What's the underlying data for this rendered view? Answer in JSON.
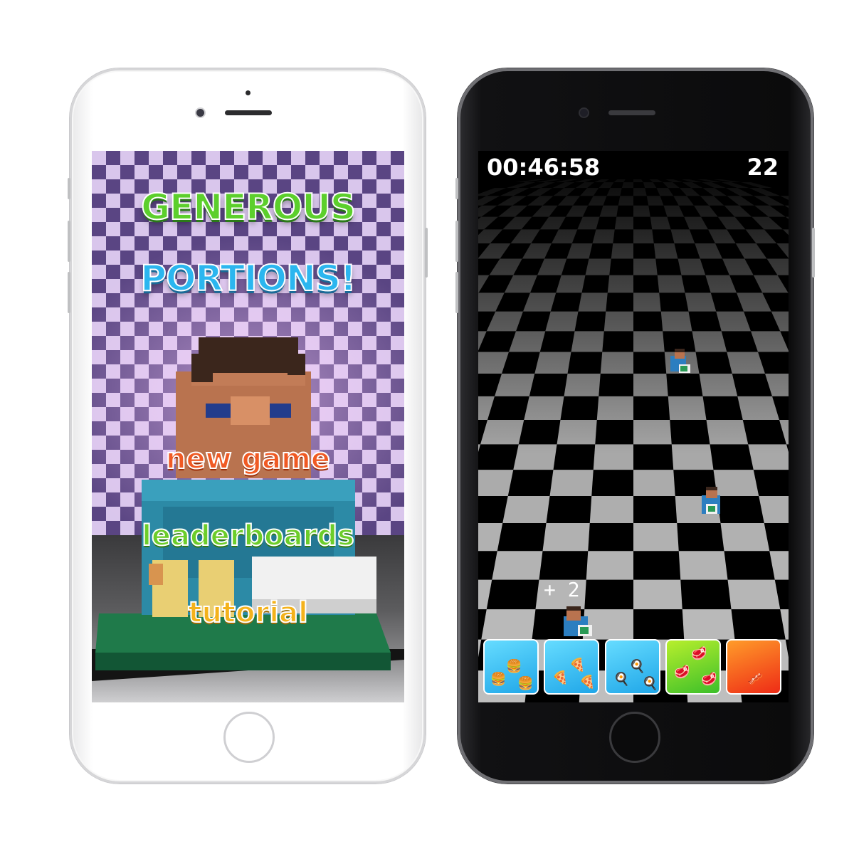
{
  "menu_screen": {
    "title_line1": "GENEROUS",
    "title_line2": "PORTIONS!",
    "menu": {
      "new_game": "new game",
      "leaderboards": "leaderboards",
      "tutorial": "tutorial"
    }
  },
  "game_screen": {
    "timer": "00:46:58",
    "score": "22",
    "combo_popup": "+ 2",
    "food_tiles": [
      {
        "food": "burger-icon",
        "color": "blue"
      },
      {
        "food": "pizza-icon",
        "color": "blue"
      },
      {
        "food": "egg-icon",
        "color": "blue"
      },
      {
        "food": "meat-icon",
        "color": "green"
      },
      {
        "food": "bacon-icon",
        "color": "red"
      }
    ]
  },
  "colors": {
    "title_green": "#5ccf2c",
    "title_blue": "#2bb6ef",
    "new_game": "#f05a24",
    "leaderboards": "#6ccd2a",
    "tutorial": "#f4b21b"
  }
}
